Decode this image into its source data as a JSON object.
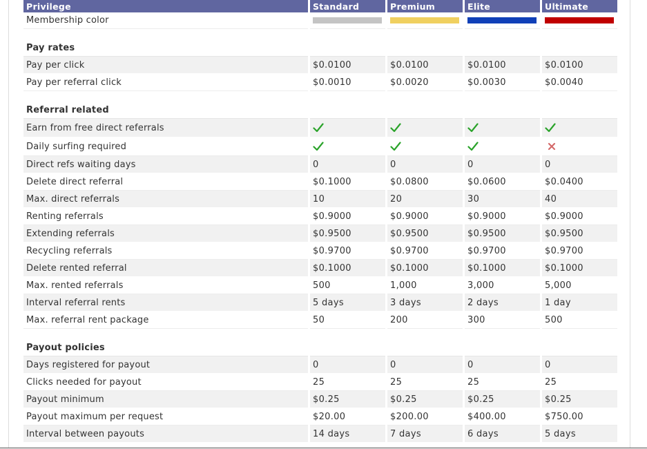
{
  "header": {
    "privilege": "Privilege",
    "tiers": [
      "Standard",
      "Premium",
      "Elite",
      "Ultimate"
    ]
  },
  "membership": {
    "label": "Membership color",
    "colors": [
      "#c4c4c4",
      "#f0d060",
      "#1040b8",
      "#c00000"
    ]
  },
  "sections": [
    {
      "title": "Pay rates",
      "rows": [
        {
          "label": "Pay per click",
          "values": [
            "$0.0100",
            "$0.0100",
            "$0.0100",
            "$0.0100"
          ]
        },
        {
          "label": "Pay per referral click",
          "values": [
            "$0.0010",
            "$0.0020",
            "$0.0030",
            "$0.0040"
          ]
        }
      ]
    },
    {
      "title": "Referral related",
      "rows": [
        {
          "label": "Earn from free direct referrals",
          "values": [
            "check-icon",
            "check-icon",
            "check-icon",
            "check-icon"
          ],
          "icons": true
        },
        {
          "label": "Daily surfing required",
          "values": [
            "check-icon",
            "check-icon",
            "check-icon",
            "cross-icon"
          ],
          "icons": true
        },
        {
          "label": "Direct refs waiting days",
          "values": [
            "0",
            "0",
            "0",
            "0"
          ]
        },
        {
          "label": "Delete direct referral",
          "values": [
            "$0.1000",
            "$0.0800",
            "$0.0600",
            "$0.0400"
          ]
        },
        {
          "label": "Max. direct referrals",
          "values": [
            "10",
            "20",
            "30",
            "40"
          ]
        },
        {
          "label": "Renting referrals",
          "values": [
            "$0.9000",
            "$0.9000",
            "$0.9000",
            "$0.9000"
          ]
        },
        {
          "label": "Extending referrals",
          "values": [
            "$0.9500",
            "$0.9500",
            "$0.9500",
            "$0.9500"
          ]
        },
        {
          "label": "Recycling referrals",
          "values": [
            "$0.9700",
            "$0.9700",
            "$0.9700",
            "$0.9700"
          ]
        },
        {
          "label": "Delete rented referral",
          "values": [
            "$0.1000",
            "$0.1000",
            "$0.1000",
            "$0.1000"
          ]
        },
        {
          "label": "Max. rented referrals",
          "values": [
            "500",
            "1,000",
            "3,000",
            "5,000"
          ]
        },
        {
          "label": "Interval referral rents",
          "values": [
            "5 days",
            "3 days",
            "2 days",
            "1 day"
          ]
        },
        {
          "label": "Max. referral rent package",
          "values": [
            "50",
            "200",
            "300",
            "500"
          ]
        }
      ]
    },
    {
      "title": "Payout policies",
      "rows": [
        {
          "label": "Days registered for payout",
          "values": [
            "0",
            "0",
            "0",
            "0"
          ]
        },
        {
          "label": "Clicks needed for payout",
          "values": [
            "25",
            "25",
            "25",
            "25"
          ]
        },
        {
          "label": "Payout minimum",
          "values": [
            "$0.25",
            "$0.25",
            "$0.25",
            "$0.25"
          ]
        },
        {
          "label": "Payout maximum per request",
          "values": [
            "$20.00",
            "$200.00",
            "$400.00",
            "$750.00"
          ]
        },
        {
          "label": "Interval between payouts",
          "values": [
            "14 days",
            "7 days",
            "6 days",
            "5 days"
          ]
        }
      ]
    }
  ]
}
